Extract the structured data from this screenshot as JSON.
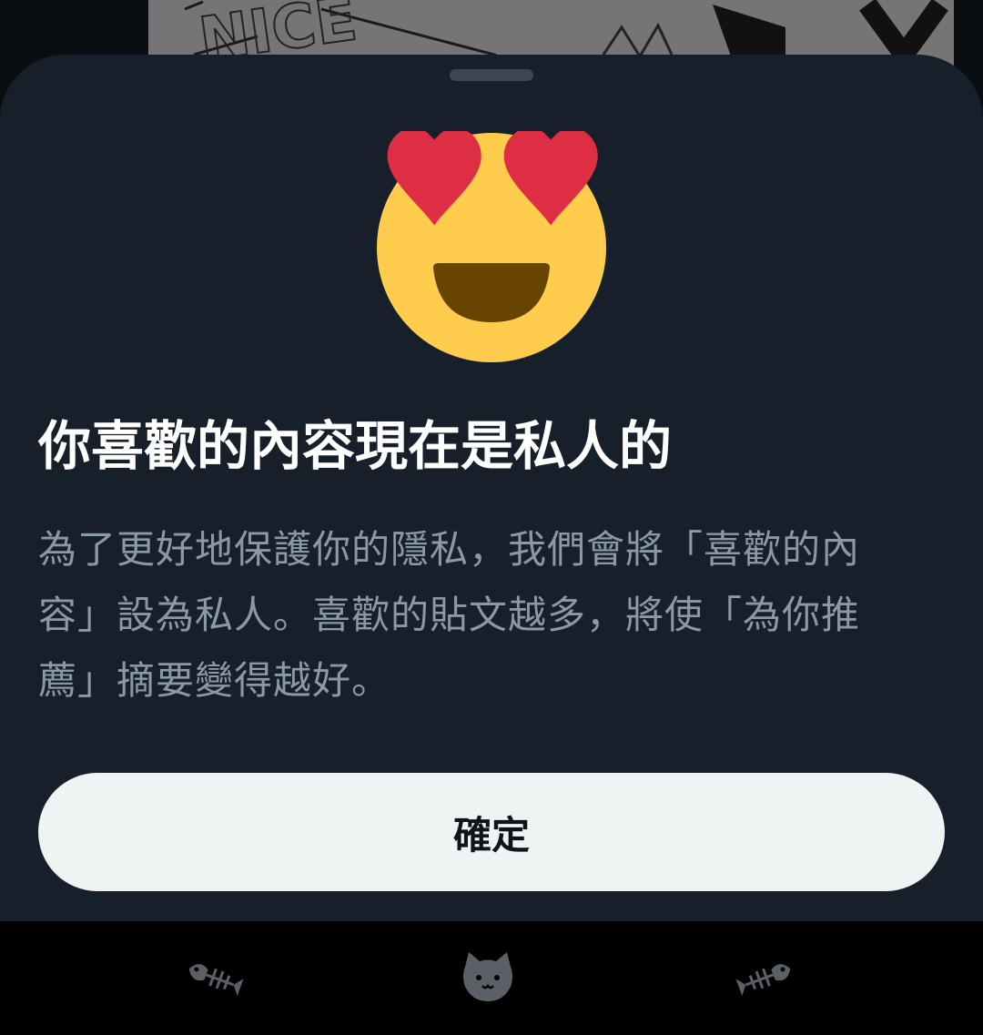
{
  "dialog": {
    "title": "你喜歡的內容現在是私人的",
    "body": "為了更好地保護你的隱私，我們會將「喜歡的內容」設為私人。喜歡的貼文越多，將使「為你推薦」摘要變得越好。",
    "confirm_label": "確定",
    "emoji": "heart-eyes-emoji-icon"
  },
  "background": {
    "image_text": "NICE"
  },
  "bottom_nav": {
    "items": [
      {
        "icon": "fish-bone-icon"
      },
      {
        "icon": "cat-face-icon"
      },
      {
        "icon": "fish-bone-icon"
      }
    ]
  },
  "colors": {
    "sheet_bg": "#17202a",
    "title": "#ffffff",
    "body": "#8b98a5",
    "button_bg": "#eff3f4",
    "button_text": "#0f1419",
    "heart": "#dd2e44",
    "face": "#ffcc4d"
  }
}
